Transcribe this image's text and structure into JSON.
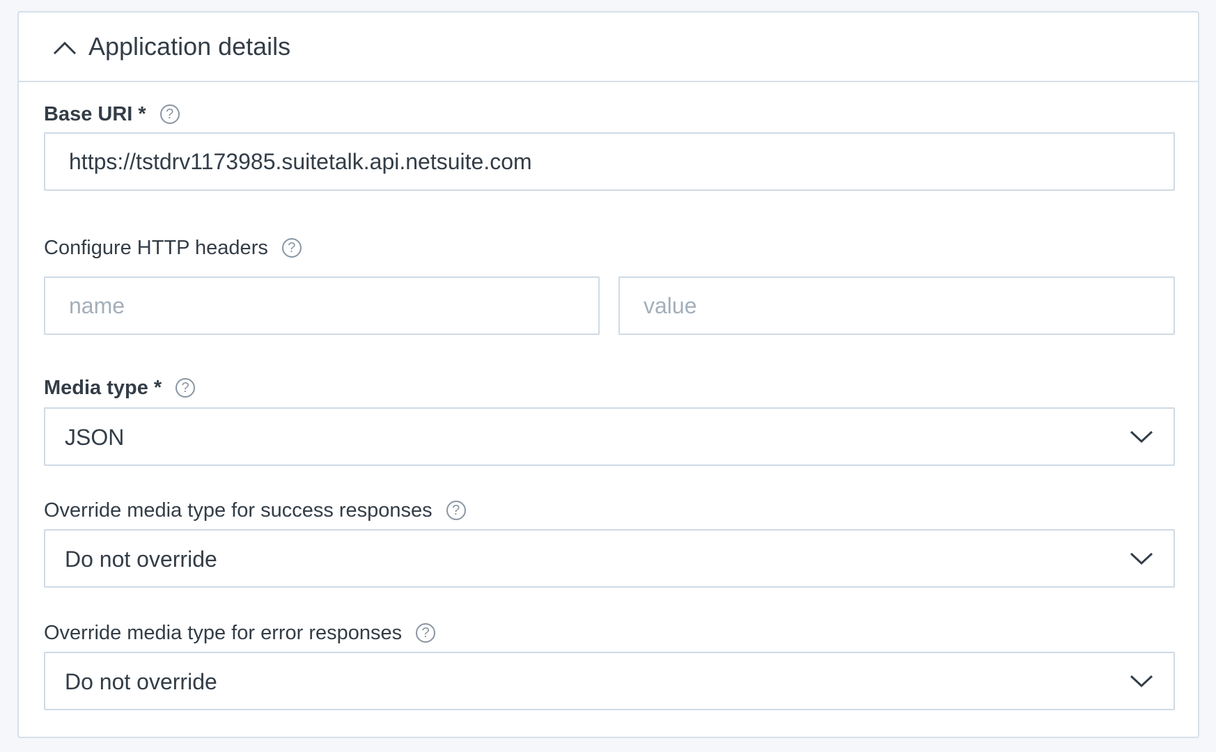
{
  "panel": {
    "title": "Application details",
    "toggle_icon": "chevron-up-icon"
  },
  "base_uri": {
    "label": "Base URI *",
    "value": "https://tstdrv1173985.suitetalk.api.netsuite.com",
    "help_icon": "question-mark"
  },
  "http_headers": {
    "label": "Configure HTTP headers",
    "name_placeholder": "name",
    "value_placeholder": "value",
    "help_icon": "question-mark"
  },
  "media_type": {
    "label": "Media type *",
    "selected": "JSON",
    "help_icon": "question-mark"
  },
  "success_override": {
    "label": "Override media type for success responses",
    "selected": "Do not override",
    "help_icon": "question-mark"
  },
  "error_override": {
    "label": "Override media type for error responses",
    "selected": "Do not override",
    "help_icon": "question-mark"
  },
  "colors": {
    "border": "#cfdae5",
    "text": "#333d47",
    "placeholder": "#a4afba",
    "background": "#f5f7fa"
  }
}
